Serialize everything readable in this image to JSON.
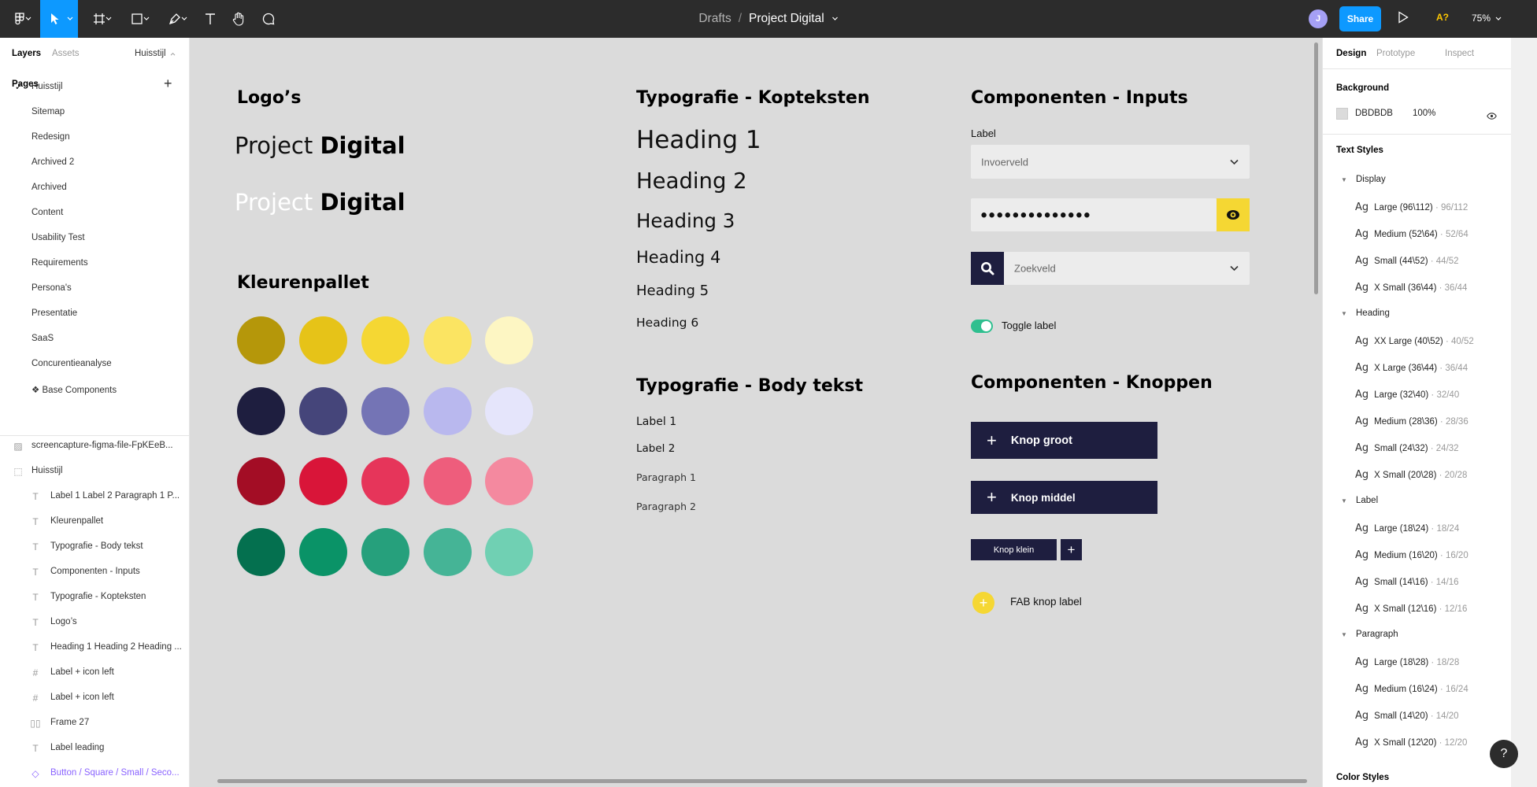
{
  "toolbar": {
    "breadcrumb": {
      "parent": "Drafts",
      "separator": "/",
      "current": "Project Digital"
    },
    "avatar_initial": "J",
    "share_label": "Share",
    "a_badge": "A?",
    "zoom": "75%",
    "tools": [
      "figma-menu-icon",
      "move-tool-icon",
      "frame-tool-icon",
      "shape-tool-icon",
      "pen-tool-icon",
      "text-tool-icon",
      "hand-tool-icon",
      "comment-tool-icon"
    ]
  },
  "left_panel": {
    "tabs": {
      "layers": "Layers",
      "assets": "Assets"
    },
    "page_switch": "Huisstijl",
    "pages_heading": "Pages",
    "pages": [
      "Huisstijl",
      "Sitemap",
      "Redesign",
      "Archived 2",
      "Archived",
      "Content",
      "Usability Test",
      "Requirements",
      "Persona's",
      "Presentatie",
      "SaaS",
      "Concurentieanalyse",
      "❖ Base Components"
    ],
    "current_page_index": 0,
    "layers": [
      {
        "icon": "image-icon",
        "label": "screencapture-figma-file-FpKEeB..."
      },
      {
        "icon": "frame-dashed-icon",
        "label": "Huisstijl"
      },
      {
        "icon": "text-layer-icon",
        "label": "Label 1 Label 2 Paragraph 1 P..."
      },
      {
        "icon": "text-layer-icon",
        "label": "Kleurenpallet"
      },
      {
        "icon": "text-layer-icon",
        "label": "Typografie - Body tekst"
      },
      {
        "icon": "text-layer-icon",
        "label": "Componenten - Inputs"
      },
      {
        "icon": "text-layer-icon",
        "label": "Typografie - Kopteksten"
      },
      {
        "icon": "text-layer-icon",
        "label": "Logo’s"
      },
      {
        "icon": "text-layer-icon",
        "label": "Heading 1 Heading 2 Heading ..."
      },
      {
        "icon": "frame-layer-icon",
        "label": "Label + icon left"
      },
      {
        "icon": "frame-layer-icon",
        "label": "Label + icon left"
      },
      {
        "icon": "autolayout-layer-icon",
        "label": "Frame 27"
      },
      {
        "icon": "text-layer-icon",
        "label": "Label leading"
      },
      {
        "icon": "component-instance-icon",
        "label": "Button / Square / Small / Seco..."
      }
    ]
  },
  "canvas": {
    "logos": {
      "title": "Logo’s",
      "light_word": "Project",
      "bold_word": "Digital"
    },
    "palette": {
      "title": "Kleurenpallet",
      "rows": [
        [
          "#b5970a",
          "#e6c318",
          "#f5d733",
          "#fbe462",
          "#fdf6c3"
        ],
        [
          "#1e1e3f",
          "#45457a",
          "#7474b5",
          "#b9b8ee",
          "#e5e5fb"
        ],
        [
          "#a30d25",
          "#d91539",
          "#e6355a",
          "#ee5d7c",
          "#f4899f"
        ],
        [
          "#04704f",
          "#0a9367",
          "#26a07c",
          "#45b496",
          "#70d0b3"
        ]
      ]
    },
    "headings": {
      "title": "Typografie - Kopteksten",
      "items": [
        "Heading 1",
        "Heading 2",
        "Heading 3",
        "Heading 4",
        "Heading 5",
        "Heading 6"
      ]
    },
    "body": {
      "title": "Typografie - Body tekst",
      "items": [
        "Label 1",
        "Label 2",
        "Paragraph 1",
        "Paragraph 2"
      ]
    },
    "inputs": {
      "title": "Componenten - Inputs",
      "label": "Label",
      "select_placeholder": "Invoerveld",
      "password_value": "●●●●●●●●●●●●●●",
      "search_placeholder": "Zoekveld",
      "toggle_label": "Toggle label",
      "toggle_on": true
    },
    "buttons": {
      "title": "Componenten - Knoppen",
      "large": "Knop groot",
      "medium": "Knop middel",
      "small": "Knop klein",
      "fab_label": "FAB knop label"
    }
  },
  "right_panel": {
    "tabs": {
      "design": "Design",
      "prototype": "Prototype",
      "inspect": "Inspect"
    },
    "background": {
      "heading": "Background",
      "hex": "DBDBDB",
      "opacity": "100%",
      "color": "#dbdbdb"
    },
    "text_styles_heading": "Text Styles",
    "ag": "Ag",
    "groups": [
      {
        "name": "Display",
        "items": [
          {
            "name": "Large (96\\112)",
            "meta": "96/112"
          },
          {
            "name": "Medium (52\\64)",
            "meta": "52/64"
          },
          {
            "name": "Small (44\\52)",
            "meta": "44/52"
          },
          {
            "name": "X Small (36\\44)",
            "meta": "36/44"
          }
        ]
      },
      {
        "name": "Heading",
        "items": [
          {
            "name": "XX Large (40\\52)",
            "meta": "40/52"
          },
          {
            "name": "X Large (36\\44)",
            "meta": "36/44"
          },
          {
            "name": "Large (32\\40)",
            "meta": "32/40"
          },
          {
            "name": "Medium (28\\36)",
            "meta": "28/36"
          },
          {
            "name": "Small (24\\32)",
            "meta": "24/32"
          },
          {
            "name": "X Small (20\\28)",
            "meta": "20/28"
          }
        ]
      },
      {
        "name": "Label",
        "items": [
          {
            "name": "Large (18\\24)",
            "meta": "18/24"
          },
          {
            "name": "Medium (16\\20)",
            "meta": "16/20"
          },
          {
            "name": "Small (14\\16)",
            "meta": "14/16"
          },
          {
            "name": "X Small (12\\16)",
            "meta": "12/16"
          }
        ]
      },
      {
        "name": "Paragraph",
        "items": [
          {
            "name": "Large (18\\28)",
            "meta": "18/28"
          },
          {
            "name": "Medium (16\\24)",
            "meta": "16/24"
          },
          {
            "name": "Small (14\\20)",
            "meta": "14/20"
          },
          {
            "name": "X Small (12\\20)",
            "meta": "12/20"
          }
        ]
      }
    ],
    "color_styles_heading": "Color Styles",
    "help": "?"
  }
}
